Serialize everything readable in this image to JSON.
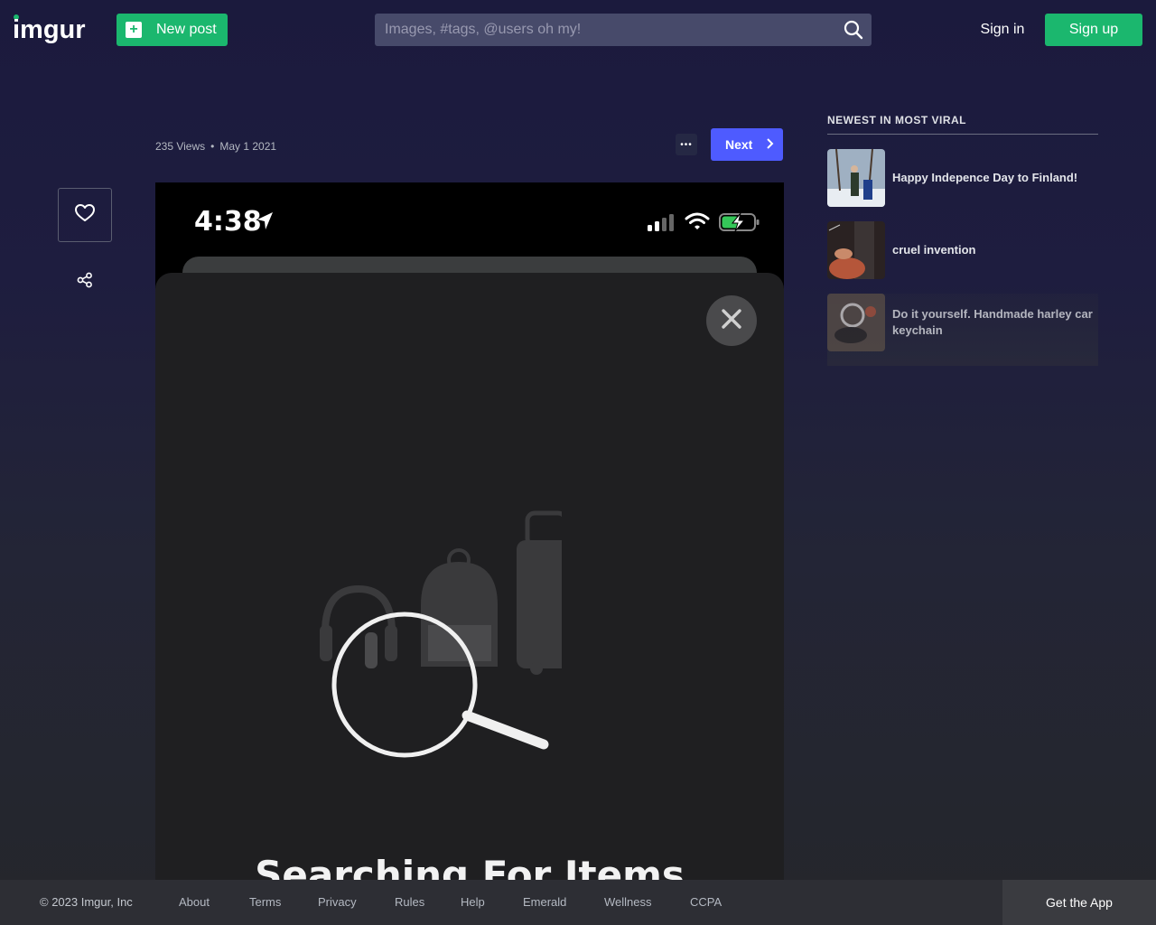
{
  "header": {
    "logo_text": "imgur",
    "new_post_label": "New post",
    "search_placeholder": "Images, #tags, @users oh my!",
    "sign_in_label": "Sign in",
    "sign_up_label": "Sign up"
  },
  "post": {
    "views": "235 Views",
    "separator": "•",
    "date": "May 1 2021",
    "more_label": "•••",
    "next_label": "Next",
    "image": {
      "status_time": "4:38",
      "heading": "Searching For Items"
    }
  },
  "sidebar": {
    "heading": "NEWEST IN MOST VIRAL",
    "items": [
      {
        "title": "Happy Indepence Day to Finland!"
      },
      {
        "title": "cruel invention"
      },
      {
        "title": "Do it yourself. Handmade harley car keychain"
      }
    ]
  },
  "footer": {
    "copyright": "© 2023 Imgur, Inc",
    "links": [
      "About",
      "Terms",
      "Privacy",
      "Rules",
      "Help",
      "Emerald",
      "Wellness",
      "CCPA"
    ],
    "get_app_label": "Get the App"
  },
  "colors": {
    "brand_green": "#1bb76e",
    "next_blue": "#4e5bff",
    "header_bg": "#1b1a3d"
  }
}
